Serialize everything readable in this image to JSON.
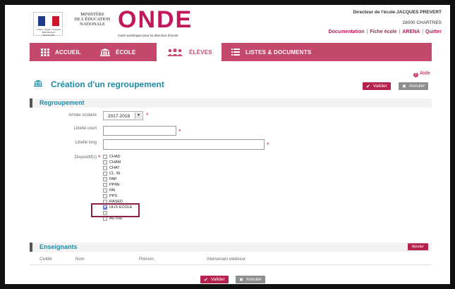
{
  "header": {
    "rf_text": "Liberté • Égalité • Fraternité RÉPUBLIQUE FRANÇAISE",
    "ministere": [
      "MINISTÈRE",
      "DE L'ÉDUCATION",
      "NATIONALE"
    ],
    "app_name": "ONDE",
    "app_subtitle": "Outil numérique pour la direction d'école",
    "director": "Directeur de l'école JACQUES PREVERT",
    "city": "28000 CHARTRES",
    "links": [
      "Documentation",
      "Fiche école",
      "ARENA",
      "Quitter"
    ]
  },
  "nav": {
    "items": [
      {
        "label": "ACCUEIL",
        "icon": "grid-icon",
        "active": false
      },
      {
        "label": "ÉCOLE",
        "icon": "building-icon",
        "active": false
      },
      {
        "label": "ÉLÈVES",
        "icon": "students-icon",
        "active": true
      },
      {
        "label": "LISTES & DOCUMENTS",
        "icon": "list-icon",
        "active": false
      }
    ]
  },
  "page": {
    "aide": "Aide",
    "title": "Création d'un regroupement",
    "valider": "Valider",
    "annuler": "Annuler"
  },
  "regroupement": {
    "section_title": "Regroupement",
    "annee_label": "Année scolaire",
    "annee_value": "2017-2018",
    "libelle_court_label": "Libellé court",
    "libelle_court_value": "",
    "libelle_long_label": "Libellé long",
    "libelle_long_value": "",
    "dispositifs_label": "Dispositif(s)",
    "dispositifs": [
      {
        "label": "CHAD",
        "checked": false
      },
      {
        "label": "CHAM",
        "checked": false
      },
      {
        "label": "CHAT",
        "checked": false
      },
      {
        "label": "CL. BI.",
        "checked": false
      },
      {
        "label": "PAP",
        "checked": false
      },
      {
        "label": "PPRE",
        "checked": false
      },
      {
        "label": "PAI",
        "checked": false
      },
      {
        "label": "PPS",
        "checked": false
      },
      {
        "label": "RASED",
        "checked": false
      },
      {
        "label": "ULIS ECOLE",
        "checked": true
      },
      {
        "label": "",
        "checked": false
      },
      {
        "label": "AUTRE",
        "checked": false
      }
    ]
  },
  "enseignants": {
    "section_title": "Enseignants",
    "ajouter": "Ajouter",
    "columns": [
      "Civilité",
      "Nom",
      "Prénom",
      "Intervenant extérieur"
    ]
  },
  "footer": {
    "valider": "Valider",
    "annuler": "Annuler"
  },
  "colors": {
    "brand": "#c4486c",
    "title": "#1b8ca8",
    "valider": "#b3234e",
    "annuler": "#8e8e8e"
  }
}
